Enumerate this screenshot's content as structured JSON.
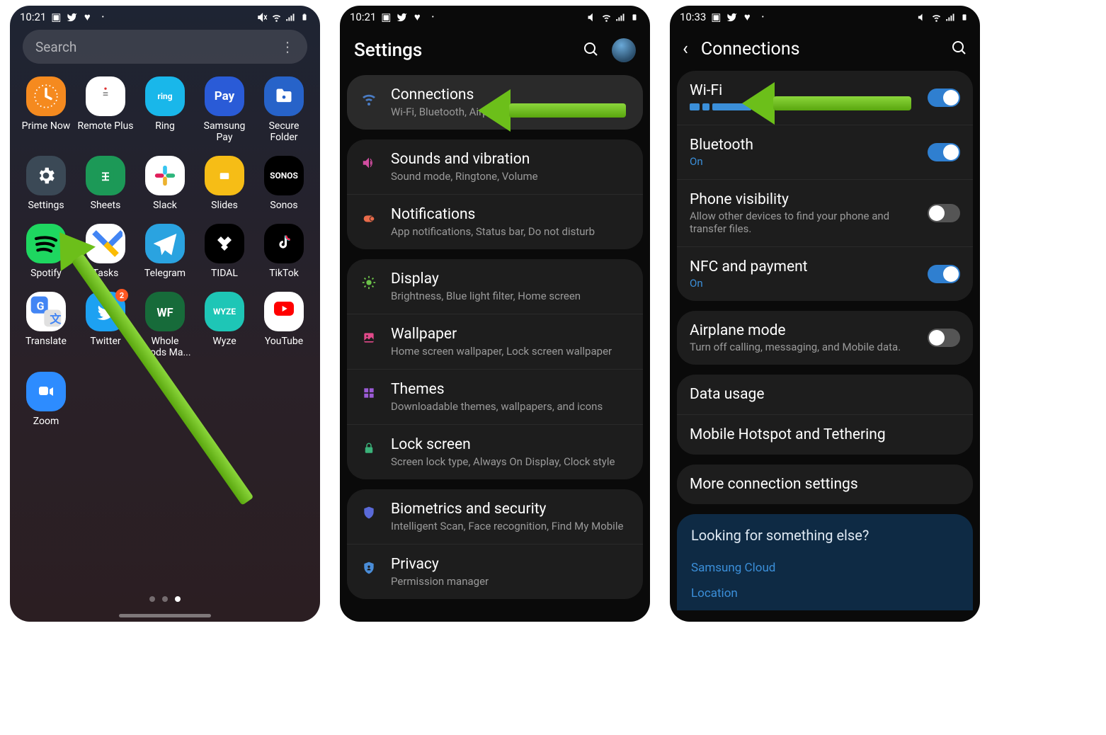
{
  "screens": {
    "s1": {
      "time": "10:21",
      "search_placeholder": "Search",
      "apps": [
        {
          "label": "Prime Now",
          "bg": "#f58a1f",
          "glyph": ""
        },
        {
          "label": "Remote Plus",
          "bg": "#ffffff",
          "glyph": ""
        },
        {
          "label": "Ring",
          "bg": "#19b7ea",
          "glyph": "ring"
        },
        {
          "label": "Samsung Pay",
          "bg": "#2a5bd7",
          "glyph": "Pay"
        },
        {
          "label": "Secure Folder",
          "bg": "#2763c9",
          "glyph": ""
        },
        {
          "label": "Settings",
          "bg": "#3b4956",
          "glyph": "⚙"
        },
        {
          "label": "Sheets",
          "bg": "#1c9957",
          "glyph": ""
        },
        {
          "label": "Slack",
          "bg": "#ffffff",
          "glyph": ""
        },
        {
          "label": "Slides",
          "bg": "#f6bd16",
          "glyph": ""
        },
        {
          "label": "Sonos",
          "bg": "#000000",
          "glyph": "SONOS"
        },
        {
          "label": "Spotify",
          "bg": "#1ed760",
          "glyph": ""
        },
        {
          "label": "Tasks",
          "bg": "#ffffff",
          "glyph": ""
        },
        {
          "label": "Telegram",
          "bg": "#2aa3e0",
          "glyph": ""
        },
        {
          "label": "TIDAL",
          "bg": "#000000",
          "glyph": ""
        },
        {
          "label": "TikTok",
          "bg": "#000000",
          "glyph": ""
        },
        {
          "label": "Translate",
          "bg": "#ffffff",
          "glyph": ""
        },
        {
          "label": "Twitter",
          "bg": "#1da1f2",
          "glyph": "",
          "badge": "2"
        },
        {
          "label": "Whole Foods Ma...",
          "bg": "#176b3a",
          "glyph": ""
        },
        {
          "label": "Wyze",
          "bg": "#1ec6b6",
          "glyph": "WYZE"
        },
        {
          "label": "YouTube",
          "bg": "#ffffff",
          "glyph": ""
        },
        {
          "label": "Zoom",
          "bg": "#2d8cff",
          "glyph": ""
        }
      ]
    },
    "s2": {
      "time": "10:21",
      "title": "Settings",
      "groups": [
        {
          "rows": [
            {
              "icon": "wifi",
              "color": "#4a7cc4",
              "title": "Connections",
              "sub": "Wi-Fi, Bluetooth, Airplane mode, Data usage",
              "hl": true
            }
          ]
        },
        {
          "rows": [
            {
              "icon": "sound",
              "color": "#d14da0",
              "title": "Sounds and vibration",
              "sub": "Sound mode, Ringtone, Volume"
            },
            {
              "icon": "notif",
              "color": "#e86b4a",
              "title": "Notifications",
              "sub": "App notifications, Status bar, Do not disturb"
            }
          ]
        },
        {
          "rows": [
            {
              "icon": "display",
              "color": "#6cc24a",
              "title": "Display",
              "sub": "Brightness, Blue light filter, Home screen"
            },
            {
              "icon": "wallpaper",
              "color": "#e24a8a",
              "title": "Wallpaper",
              "sub": "Home screen wallpaper, Lock screen wallpaper"
            },
            {
              "icon": "themes",
              "color": "#9b5bd6",
              "title": "Themes",
              "sub": "Downloadable themes, wallpapers, and icons"
            },
            {
              "icon": "lock",
              "color": "#3bb27a",
              "title": "Lock screen",
              "sub": "Screen lock type, Always On Display, Clock style"
            }
          ]
        },
        {
          "rows": [
            {
              "icon": "shield",
              "color": "#5a6ad8",
              "title": "Biometrics and security",
              "sub": "Intelligent Scan, Face recognition, Find My Mobile"
            },
            {
              "icon": "privacy",
              "color": "#4a8dd8",
              "title": "Privacy",
              "sub": "Permission manager"
            }
          ]
        }
      ]
    },
    "s3": {
      "time": "10:33",
      "title": "Connections",
      "groups": [
        {
          "rows": [
            {
              "title": "Wi-Fi",
              "sub_redacted": true,
              "toggle": true,
              "on": true
            },
            {
              "title": "Bluetooth",
              "sub": "On",
              "sub_blue": true,
              "toggle": true,
              "on": true
            },
            {
              "title": "Phone visibility",
              "sub": "Allow other devices to find your phone and transfer files.",
              "toggle": true,
              "on": false
            },
            {
              "title": "NFC and payment",
              "sub": "On",
              "sub_blue": true,
              "toggle": true,
              "on": true
            }
          ]
        },
        {
          "rows": [
            {
              "title": "Airplane mode",
              "sub": "Turn off calling, messaging, and Mobile data.",
              "toggle": true,
              "on": false
            }
          ]
        },
        {
          "rows": [
            {
              "title": "Data usage"
            },
            {
              "title": "Mobile Hotspot and Tethering"
            }
          ]
        },
        {
          "rows": [
            {
              "title": "More connection settings"
            }
          ]
        }
      ],
      "help": {
        "title": "Looking for something else?",
        "links": [
          "Samsung Cloud",
          "Location"
        ]
      }
    }
  }
}
